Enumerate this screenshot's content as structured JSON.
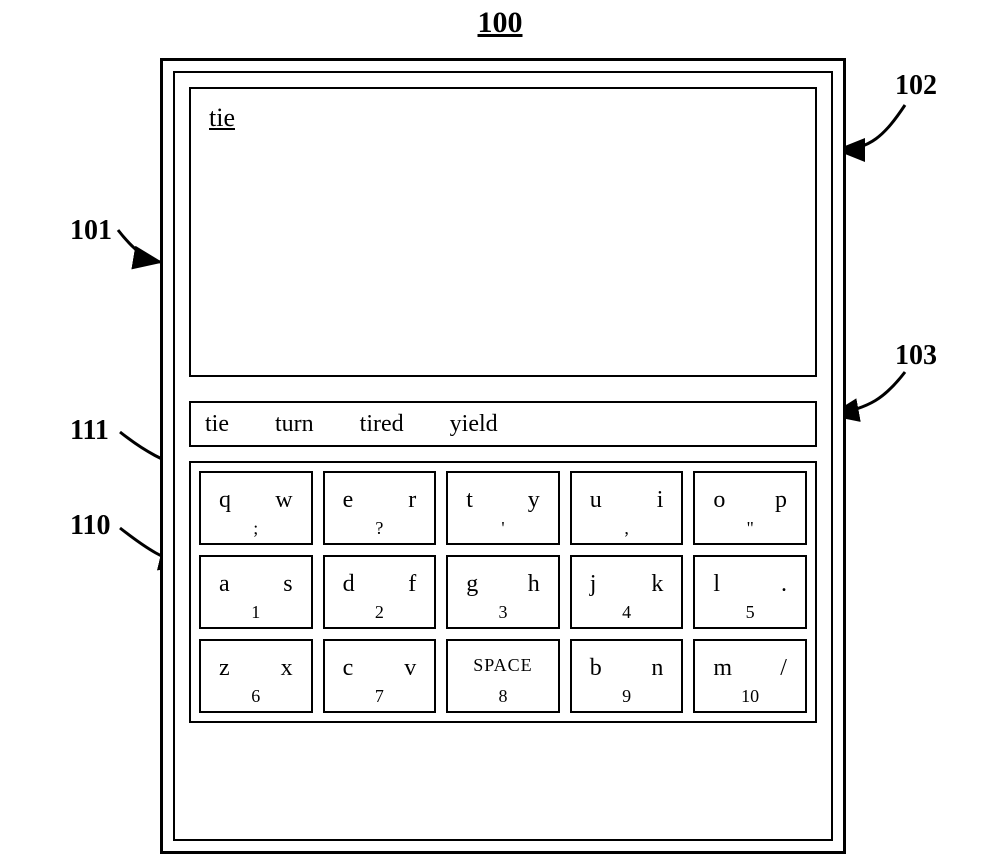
{
  "figure_label": "100",
  "typed_text": "tie",
  "suggestions": [
    "tie",
    "turn",
    "tired",
    "yield"
  ],
  "keyboard": {
    "rows": [
      [
        {
          "left": "q",
          "right": "w",
          "sub": ";"
        },
        {
          "left": "e",
          "right": "r",
          "sub": "?"
        },
        {
          "left": "t",
          "right": "y",
          "sub": "'"
        },
        {
          "left": "u",
          "right": "i",
          "sub": ","
        },
        {
          "left": "o",
          "right": "p",
          "sub": "\""
        }
      ],
      [
        {
          "left": "a",
          "right": "s",
          "sub": "1"
        },
        {
          "left": "d",
          "right": "f",
          "sub": "2"
        },
        {
          "left": "g",
          "right": "h",
          "sub": "3"
        },
        {
          "left": "j",
          "right": "k",
          "sub": "4"
        },
        {
          "left": "l",
          "right": ".",
          "sub": "5"
        }
      ],
      [
        {
          "left": "z",
          "right": "x",
          "sub": "6"
        },
        {
          "left": "c",
          "right": "v",
          "sub": "7"
        },
        {
          "center": "SPACE",
          "sub": "8"
        },
        {
          "left": "b",
          "right": "n",
          "sub": "9"
        },
        {
          "left": "m",
          "right": "/",
          "sub": "10"
        }
      ]
    ]
  },
  "callouts": {
    "c100": "100",
    "c101": "101",
    "c102": "102",
    "c103": "103",
    "c110": "110",
    "c111": "111"
  }
}
